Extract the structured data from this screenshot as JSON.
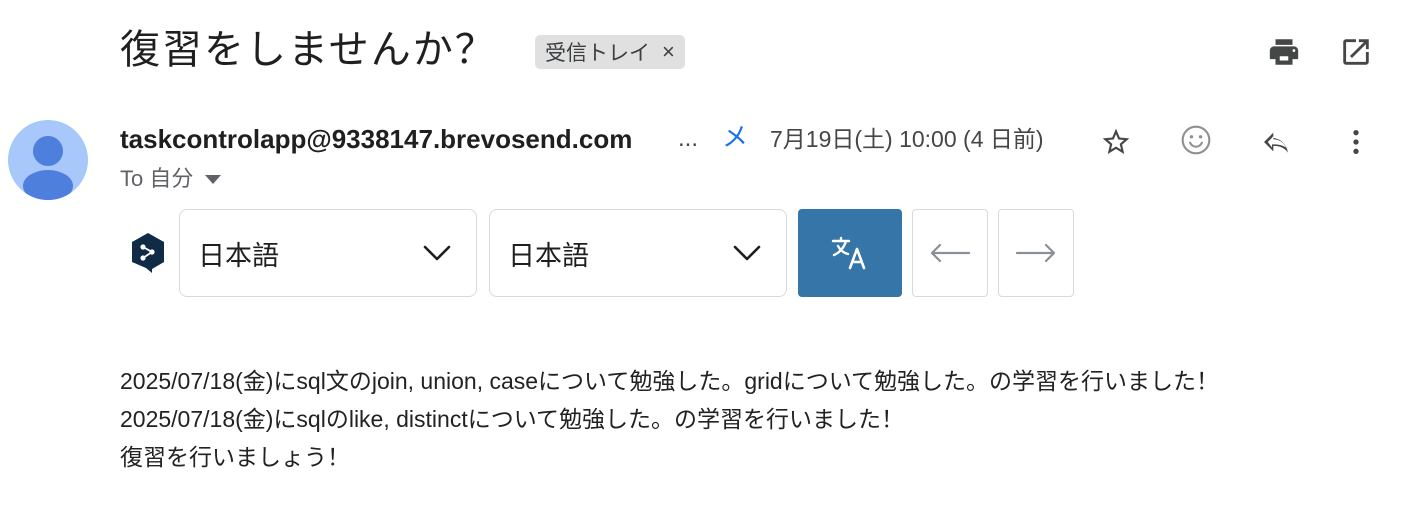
{
  "email": {
    "subject": "復習をしませんか？",
    "label": "受信トレイ",
    "label_remove": "×",
    "sender": "taskcontrolapp@9338147.brevosend.com",
    "sender_truncation": "...",
    "separator": "メ",
    "date": "7月19日(土) 10:00 (4 日前)",
    "to": "To 自分",
    "body_lines": [
      "2025/07/18(金)にsql文のjoin, union, caseについて勉強した。gridについて勉強した。の学習を行いました！",
      "2025/07/18(金)にsqlのlike, distinctについて勉強した。の学習を行いました！",
      "復習を行いましょう！"
    ]
  },
  "translator": {
    "source_language": "日本語",
    "target_language": "日本語",
    "brand_color": "#3575a7"
  },
  "icons": {
    "print": "print-icon",
    "open_new": "open-in-new-icon",
    "star": "star-icon",
    "emoji": "emoji-icon",
    "reply": "reply-icon",
    "more": "more-vert-icon",
    "translate": "translate-icon",
    "prev": "arrow-left-icon",
    "next": "arrow-right-icon",
    "deepl": "deepl-logo"
  },
  "colors": {
    "accent": "#1a73e8",
    "avatar_bg": "#a8c7fa",
    "avatar_fg": "#4f7fdc"
  }
}
